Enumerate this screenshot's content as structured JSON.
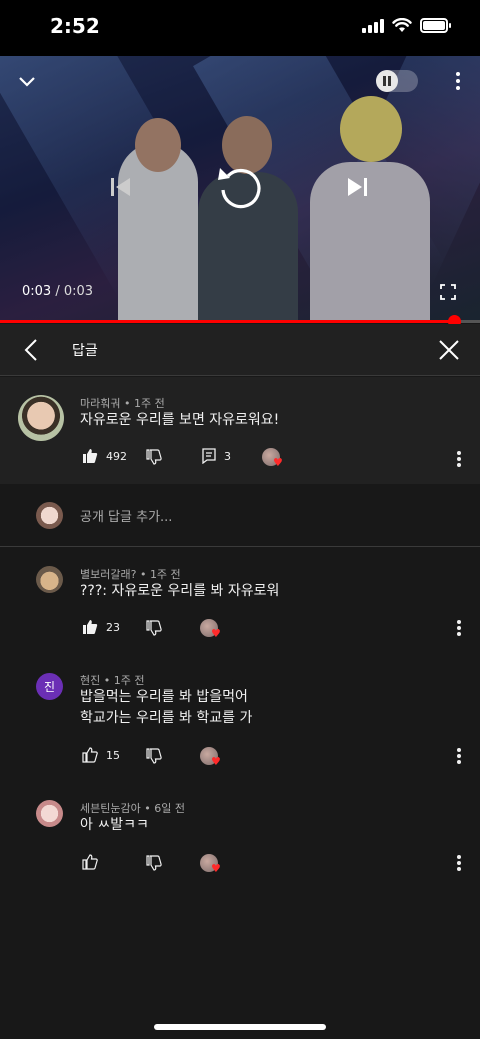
{
  "status": {
    "time": "2:52"
  },
  "video": {
    "current_time": "0:03",
    "separator": " / ",
    "duration": "0:03",
    "progress": 0.945
  },
  "header": {
    "title": "답글"
  },
  "parent": {
    "author": "마라훠궈",
    "age": "1주 전",
    "text": "자유로운 우리를 보면 자유로워요!",
    "likes": "492",
    "replies": "3"
  },
  "add_reply": {
    "placeholder": "공개 답글 추가..."
  },
  "replies": [
    {
      "author": "별보러갈래?",
      "age": "1주 전",
      "lines": [
        "???: 자유로운 우리를 봐 자유로워"
      ],
      "likes": "23",
      "liked": true
    },
    {
      "author": "현진",
      "age": "1주 전",
      "avatar_letter": "진",
      "avatar_color": "#6b2fb5",
      "lines": [
        "밥을먹는 우리를 봐 밥을먹어",
        "학교가는 우리를 봐 학교를 가"
      ],
      "likes": "15",
      "liked": false
    },
    {
      "author": "세븐틴눈감아",
      "age": "6일 전",
      "lines": [
        "아 ㅆ발ㅋㅋ"
      ],
      "likes": "",
      "liked": false
    }
  ],
  "colors": {
    "accent": "#ff0000",
    "background": "#181818",
    "panel": "#212121"
  },
  "icons": [
    "collapse-icon",
    "pause-icon",
    "more-vert-icon",
    "previous-icon",
    "replay-icon",
    "next-icon",
    "fullscreen-icon",
    "back-icon",
    "close-icon",
    "thumb-up-icon",
    "thumb-down-icon",
    "reply-icon",
    "heart-icon"
  ]
}
